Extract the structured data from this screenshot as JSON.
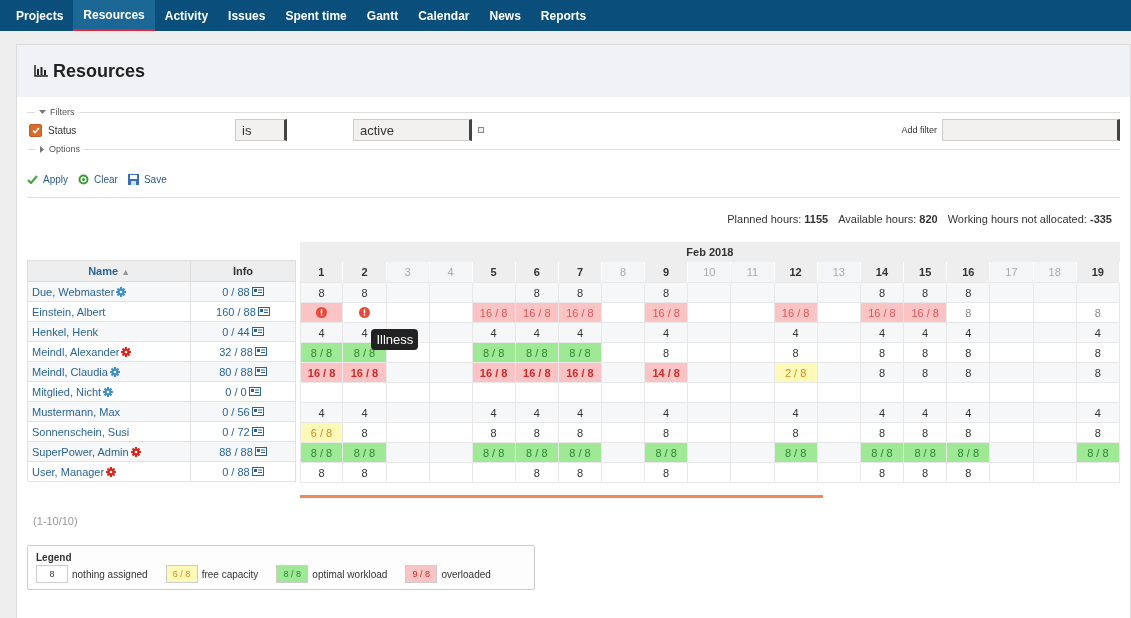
{
  "nav": [
    {
      "label": "Projects",
      "selected": false
    },
    {
      "label": "Resources",
      "selected": true
    },
    {
      "label": "Activity",
      "selected": false
    },
    {
      "label": "Issues",
      "selected": false
    },
    {
      "label": "Spent time",
      "selected": false
    },
    {
      "label": "Gantt",
      "selected": false
    },
    {
      "label": "Calendar",
      "selected": false
    },
    {
      "label": "News",
      "selected": false
    },
    {
      "label": "Reports",
      "selected": false
    }
  ],
  "title": "Resources",
  "filters": {
    "legend": "Filters",
    "expanded": true,
    "rows": [
      {
        "label": "Status",
        "checked": true,
        "operator": "is",
        "value": "active"
      }
    ],
    "add_filter_label": "Add filter",
    "options_legend": "Options",
    "options_expanded": false
  },
  "actions": [
    {
      "kind": "apply",
      "label": "Apply"
    },
    {
      "kind": "clear",
      "label": "Clear"
    },
    {
      "kind": "save",
      "label": "Save"
    }
  ],
  "totals": [
    {
      "label": "Planned hours:",
      "value": "1155"
    },
    {
      "label": "Available hours:",
      "value": "820"
    },
    {
      "label": "Working hours not allocated:",
      "value": "-335"
    }
  ],
  "table": {
    "name_header": "Name",
    "sort_icon": "▲",
    "info_header": "Info",
    "month": "Feb 2018",
    "days": [
      {
        "label": "1",
        "weekend": false
      },
      {
        "label": "2",
        "weekend": false
      },
      {
        "label": "3",
        "weekend": true
      },
      {
        "label": "4",
        "weekend": true
      },
      {
        "label": "5",
        "weekend": false
      },
      {
        "label": "6",
        "weekend": false
      },
      {
        "label": "7",
        "weekend": false
      },
      {
        "label": "8",
        "weekend": true
      },
      {
        "label": "9",
        "weekend": false
      },
      {
        "label": "10",
        "weekend": true
      },
      {
        "label": "11",
        "weekend": true
      },
      {
        "label": "12",
        "weekend": false
      },
      {
        "label": "13",
        "weekend": true
      },
      {
        "label": "14",
        "weekend": false
      },
      {
        "label": "15",
        "weekend": false
      },
      {
        "label": "16",
        "weekend": false
      },
      {
        "label": "17",
        "weekend": true
      },
      {
        "label": "18",
        "weekend": true
      },
      {
        "label": "19",
        "weekend": false
      }
    ],
    "rows": [
      {
        "name": "Due, Webmaster",
        "color": "#3f8fc4",
        "info": "0 / 88",
        "cells": [
          {
            "kind": "plain",
            "text": "8"
          },
          {
            "kind": "plain",
            "text": "8"
          },
          {
            "kind": "empty"
          },
          {
            "kind": "empty"
          },
          {
            "kind": "empty"
          },
          {
            "kind": "plain",
            "text": "8"
          },
          {
            "kind": "plain",
            "text": "8"
          },
          {
            "kind": "empty"
          },
          {
            "kind": "plain",
            "text": "8"
          },
          {
            "kind": "empty"
          },
          {
            "kind": "empty"
          },
          {
            "kind": "empty"
          },
          {
            "kind": "empty"
          },
          {
            "kind": "plain",
            "text": "8"
          },
          {
            "kind": "plain",
            "text": "8"
          },
          {
            "kind": "plain",
            "text": "8"
          },
          {
            "kind": "empty"
          },
          {
            "kind": "empty"
          },
          {
            "kind": "empty"
          }
        ]
      },
      {
        "name": "Einstein, Albert",
        "info": "160 / 88",
        "cells": [
          {
            "kind": "alert_bg"
          },
          {
            "kind": "alert"
          },
          {
            "kind": "empty"
          },
          {
            "kind": "empty"
          },
          {
            "kind": "over_faint",
            "text": "16 / 8"
          },
          {
            "kind": "over_faint",
            "text": "16 / 8"
          },
          {
            "kind": "over_faint",
            "text": "16 / 8"
          },
          {
            "kind": "empty"
          },
          {
            "kind": "over_faint",
            "text": "16 / 8"
          },
          {
            "kind": "empty"
          },
          {
            "kind": "empty"
          },
          {
            "kind": "over_faint",
            "text": "16 / 8"
          },
          {
            "kind": "empty"
          },
          {
            "kind": "over_faint",
            "text": "16 / 8"
          },
          {
            "kind": "over_faint",
            "text": "16 / 8"
          },
          {
            "kind": "plain_faint",
            "text": "8"
          },
          {
            "kind": "empty"
          },
          {
            "kind": "empty"
          },
          {
            "kind": "plain_faint",
            "text": "8"
          }
        ]
      },
      {
        "name": "Henkel, Henk",
        "info": "0 / 44",
        "cells": [
          {
            "kind": "plain",
            "text": "4"
          },
          {
            "kind": "plain",
            "text": "4"
          },
          {
            "kind": "empty"
          },
          {
            "kind": "empty"
          },
          {
            "kind": "plain",
            "text": "4"
          },
          {
            "kind": "plain",
            "text": "4"
          },
          {
            "kind": "plain",
            "text": "4"
          },
          {
            "kind": "empty"
          },
          {
            "kind": "plain",
            "text": "4"
          },
          {
            "kind": "empty"
          },
          {
            "kind": "empty"
          },
          {
            "kind": "plain",
            "text": "4"
          },
          {
            "kind": "empty"
          },
          {
            "kind": "plain",
            "text": "4"
          },
          {
            "kind": "plain",
            "text": "4"
          },
          {
            "kind": "plain",
            "text": "4"
          },
          {
            "kind": "empty"
          },
          {
            "kind": "empty"
          },
          {
            "kind": "plain",
            "text": "4"
          }
        ]
      },
      {
        "name": "Meindl, Alexander",
        "color": "#d8231b",
        "info": "32 / 88",
        "cells": [
          {
            "kind": "ok",
            "text": "8 / 8"
          },
          {
            "kind": "ok",
            "text": "8 / 8"
          },
          {
            "kind": "empty"
          },
          {
            "kind": "empty"
          },
          {
            "kind": "ok",
            "text": "8 / 8"
          },
          {
            "kind": "ok",
            "text": "8 / 8"
          },
          {
            "kind": "ok",
            "text": "8 / 8"
          },
          {
            "kind": "empty"
          },
          {
            "kind": "plain",
            "text": "8"
          },
          {
            "kind": "empty"
          },
          {
            "kind": "empty"
          },
          {
            "kind": "plain",
            "text": "8"
          },
          {
            "kind": "empty"
          },
          {
            "kind": "plain",
            "text": "8"
          },
          {
            "kind": "plain",
            "text": "8"
          },
          {
            "kind": "plain",
            "text": "8"
          },
          {
            "kind": "empty"
          },
          {
            "kind": "empty"
          },
          {
            "kind": "plain",
            "text": "8"
          }
        ]
      },
      {
        "name": "Meindl, Claudia",
        "color": "#3f8fc4",
        "info": "80 / 88",
        "cells": [
          {
            "kind": "over",
            "text": "16 / 8"
          },
          {
            "kind": "over",
            "text": "16 / 8"
          },
          {
            "kind": "empty"
          },
          {
            "kind": "empty"
          },
          {
            "kind": "over",
            "text": "16 / 8"
          },
          {
            "kind": "over",
            "text": "16 / 8"
          },
          {
            "kind": "over",
            "text": "16 / 8"
          },
          {
            "kind": "empty"
          },
          {
            "kind": "over",
            "text": "14 / 8"
          },
          {
            "kind": "empty"
          },
          {
            "kind": "empty"
          },
          {
            "kind": "free",
            "text": "2 / 8"
          },
          {
            "kind": "empty"
          },
          {
            "kind": "plain",
            "text": "8"
          },
          {
            "kind": "plain",
            "text": "8"
          },
          {
            "kind": "plain",
            "text": "8"
          },
          {
            "kind": "empty"
          },
          {
            "kind": "empty"
          },
          {
            "kind": "plain",
            "text": "8"
          }
        ]
      },
      {
        "name": "Mitglied, Nicht",
        "color": "#3f8fc4",
        "info": "0 / 0",
        "cells": [
          {
            "kind": "empty"
          },
          {
            "kind": "empty"
          },
          {
            "kind": "empty"
          },
          {
            "kind": "empty"
          },
          {
            "kind": "empty"
          },
          {
            "kind": "empty"
          },
          {
            "kind": "empty"
          },
          {
            "kind": "empty"
          },
          {
            "kind": "empty"
          },
          {
            "kind": "empty"
          },
          {
            "kind": "empty"
          },
          {
            "kind": "empty"
          },
          {
            "kind": "empty"
          },
          {
            "kind": "empty"
          },
          {
            "kind": "empty"
          },
          {
            "kind": "empty"
          },
          {
            "kind": "empty"
          },
          {
            "kind": "empty"
          },
          {
            "kind": "empty"
          }
        ]
      },
      {
        "name": "Mustermann, Max",
        "info": "0 / 56",
        "cells": [
          {
            "kind": "plain",
            "text": "4"
          },
          {
            "kind": "plain",
            "text": "4"
          },
          {
            "kind": "empty"
          },
          {
            "kind": "empty"
          },
          {
            "kind": "plain",
            "text": "4"
          },
          {
            "kind": "plain",
            "text": "4"
          },
          {
            "kind": "plain",
            "text": "4"
          },
          {
            "kind": "empty"
          },
          {
            "kind": "plain",
            "text": "4"
          },
          {
            "kind": "empty"
          },
          {
            "kind": "empty"
          },
          {
            "kind": "plain",
            "text": "4"
          },
          {
            "kind": "empty"
          },
          {
            "kind": "plain",
            "text": "4"
          },
          {
            "kind": "plain",
            "text": "4"
          },
          {
            "kind": "plain",
            "text": "4"
          },
          {
            "kind": "empty"
          },
          {
            "kind": "empty"
          },
          {
            "kind": "plain",
            "text": "4"
          }
        ]
      },
      {
        "name": "Sonnenschein, Susi",
        "info": "0 / 72",
        "cells": [
          {
            "kind": "free",
            "text": "6 / 8"
          },
          {
            "kind": "plain",
            "text": "8"
          },
          {
            "kind": "empty"
          },
          {
            "kind": "empty"
          },
          {
            "kind": "plain",
            "text": "8"
          },
          {
            "kind": "plain",
            "text": "8"
          },
          {
            "kind": "plain",
            "text": "8"
          },
          {
            "kind": "empty"
          },
          {
            "kind": "plain",
            "text": "8"
          },
          {
            "kind": "empty"
          },
          {
            "kind": "empty"
          },
          {
            "kind": "plain",
            "text": "8"
          },
          {
            "kind": "empty"
          },
          {
            "kind": "plain",
            "text": "8"
          },
          {
            "kind": "plain",
            "text": "8"
          },
          {
            "kind": "plain",
            "text": "8"
          },
          {
            "kind": "empty"
          },
          {
            "kind": "empty"
          },
          {
            "kind": "plain",
            "text": "8"
          }
        ]
      },
      {
        "name": "SuperPower, Admin",
        "color": "#d8231b",
        "info": "88 / 88",
        "cells": [
          {
            "kind": "ok",
            "text": "8 / 8"
          },
          {
            "kind": "ok",
            "text": "8 / 8"
          },
          {
            "kind": "empty"
          },
          {
            "kind": "empty"
          },
          {
            "kind": "ok",
            "text": "8 / 8"
          },
          {
            "kind": "ok",
            "text": "8 / 8"
          },
          {
            "kind": "ok",
            "text": "8 / 8"
          },
          {
            "kind": "empty"
          },
          {
            "kind": "ok",
            "text": "8 / 8"
          },
          {
            "kind": "empty"
          },
          {
            "kind": "empty"
          },
          {
            "kind": "ok",
            "text": "8 / 8"
          },
          {
            "kind": "empty"
          },
          {
            "kind": "ok",
            "text": "8 / 8"
          },
          {
            "kind": "ok",
            "text": "8 / 8"
          },
          {
            "kind": "ok",
            "text": "8 / 8"
          },
          {
            "kind": "empty"
          },
          {
            "kind": "empty"
          },
          {
            "kind": "ok",
            "text": "8 / 8"
          }
        ]
      },
      {
        "name": "User, Manager",
        "color": "#d8231b",
        "info": "0 / 88",
        "cells": [
          {
            "kind": "plain",
            "text": "8"
          },
          {
            "kind": "plain",
            "text": "8"
          },
          {
            "kind": "empty"
          },
          {
            "kind": "empty"
          },
          {
            "kind": "empty"
          },
          {
            "kind": "plain",
            "text": "8"
          },
          {
            "kind": "plain",
            "text": "8"
          },
          {
            "kind": "empty"
          },
          {
            "kind": "plain",
            "text": "8"
          },
          {
            "kind": "empty"
          },
          {
            "kind": "empty"
          },
          {
            "kind": "empty"
          },
          {
            "kind": "empty"
          },
          {
            "kind": "plain",
            "text": "8"
          },
          {
            "kind": "plain",
            "text": "8"
          },
          {
            "kind": "plain",
            "text": "8"
          },
          {
            "kind": "empty"
          },
          {
            "kind": "empty"
          },
          {
            "kind": "empty"
          }
        ]
      }
    ]
  },
  "tooltip": "Illness",
  "count": "(1-10/10)",
  "legend": {
    "title": "Legend",
    "items": [
      {
        "kind": "plain",
        "sample": "8",
        "label": "nothing assigned"
      },
      {
        "kind": "free",
        "sample": "6 / 8",
        "label": "free capacity"
      },
      {
        "kind": "ok",
        "sample": "8 / 8",
        "label": "optimal workload"
      },
      {
        "kind": "over",
        "sample": "9 / 8",
        "label": "overloaded"
      }
    ]
  }
}
